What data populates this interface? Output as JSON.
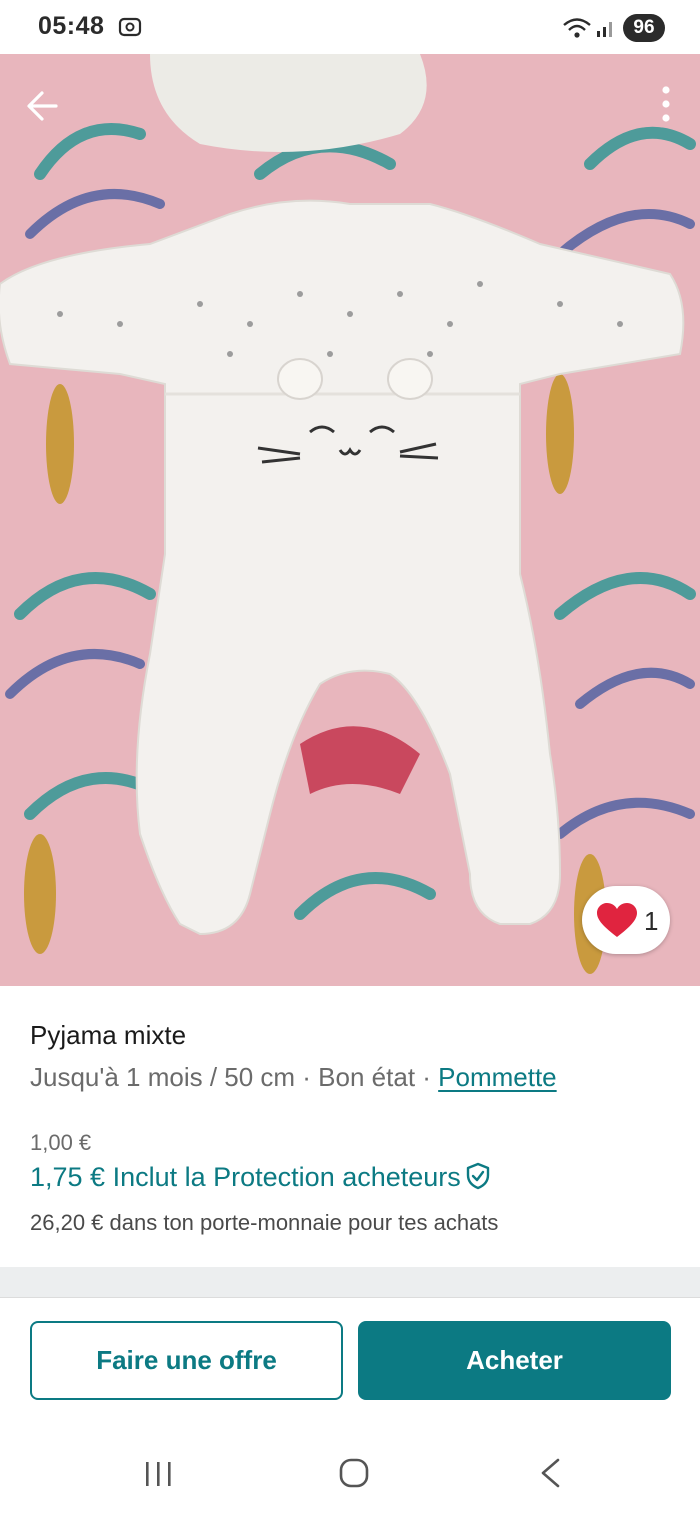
{
  "status_bar": {
    "time": "05:48",
    "battery": "96",
    "icons": [
      "screenshot-icon",
      "wifi-icon",
      "signal-icon"
    ]
  },
  "photo": {
    "description_icons": [
      "back-arrow-icon",
      "more-vertical-icon"
    ],
    "likes": "1",
    "colors": {
      "heart": "#e0243f",
      "background": "#e9b9bf"
    }
  },
  "product": {
    "title": "Pyjama mixte",
    "meta_prefix": "Jusqu'à 1 mois / 50 cm · Bon état · ",
    "brand": "Pommette",
    "price": "1,00 €",
    "price_total": "1,75 €",
    "protection_label": "Inclut la Protection acheteurs",
    "wallet_note": "26,20 € dans ton porte-monnaie pour tes achats"
  },
  "actions": {
    "offer_label": "Faire une offre",
    "buy_label": "Acheter"
  },
  "theme": {
    "accent": "#0c7a83",
    "muted_text": "#6b6b6b"
  }
}
